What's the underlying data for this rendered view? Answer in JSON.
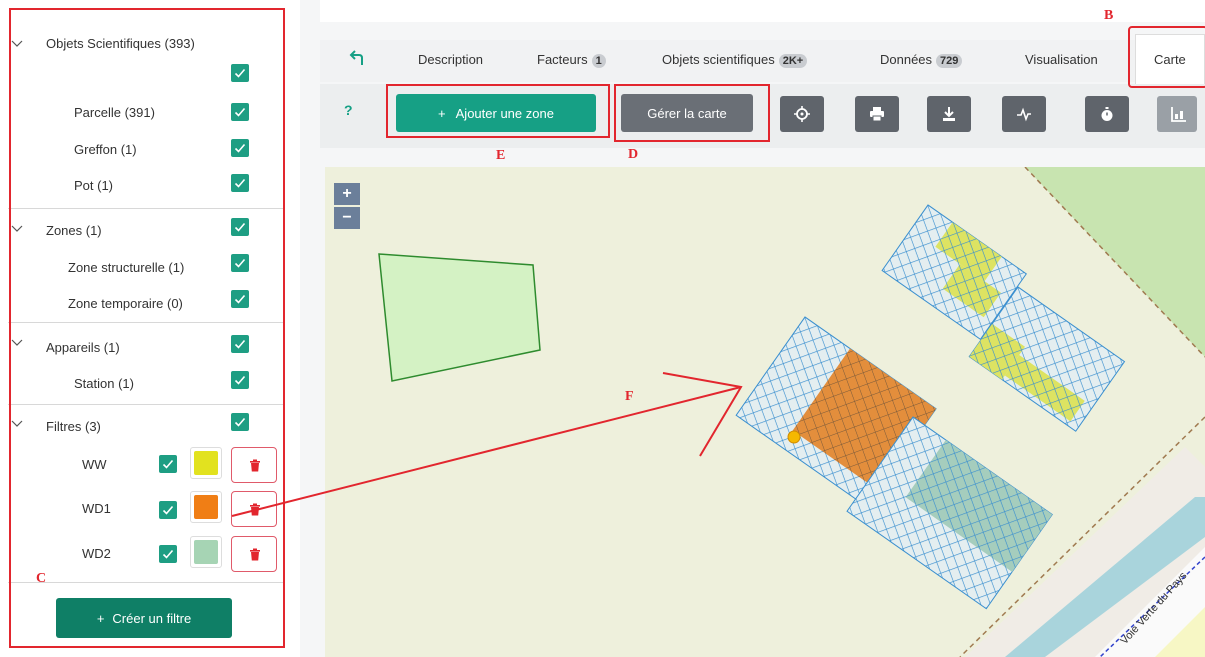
{
  "sidebar": {
    "groups": [
      {
        "label": "Objets Scientifiques (393)",
        "items": [
          "Parcelle (391)",
          "Greffon (1)",
          "Pot (1)"
        ]
      },
      {
        "label": "Zones (1)",
        "items": [
          "Zone structurelle (1)",
          "Zone temporaire (0)"
        ]
      },
      {
        "label": "Appareils (1)",
        "items": [
          "Station (1)"
        ]
      },
      {
        "label": "Filtres (3)",
        "filters": [
          {
            "name": "WW",
            "color": "#e2e21f"
          },
          {
            "name": "WD1",
            "color": "#f07e15"
          },
          {
            "name": "WD2",
            "color": "#a6d4b4"
          }
        ]
      }
    ],
    "create_filter_label": "Créer un filtre"
  },
  "tabs": {
    "items": [
      {
        "label": "Description",
        "badge": ""
      },
      {
        "label": "Facteurs",
        "badge": "1"
      },
      {
        "label": "Objets scientifiques",
        "badge": "2K+"
      },
      {
        "label": "Données",
        "badge": "729"
      },
      {
        "label": "Visualisation",
        "badge": ""
      },
      {
        "label": "Carte",
        "badge": ""
      }
    ]
  },
  "toolbar": {
    "help": "?",
    "add_zone_label": "Ajouter une zone",
    "manage_map_label": "Gérer la carte"
  },
  "map": {
    "zoom_in": "+",
    "zoom_out": "−",
    "road_label": "Voie Verte du Pays"
  },
  "annotations": {
    "B": "B",
    "C": "C",
    "D": "D",
    "E": "E",
    "F": "F"
  },
  "colors": {
    "accent_green": "#16a085",
    "dark_green": "#0f7f66",
    "annotation_red": "#e2262e",
    "plot_blue": "#3a8fcf",
    "plot_orange": "#e38e3c",
    "plot_yellow": "#dde362",
    "plot_teal": "#a5cdbd",
    "zone_green": "#4caf50"
  }
}
